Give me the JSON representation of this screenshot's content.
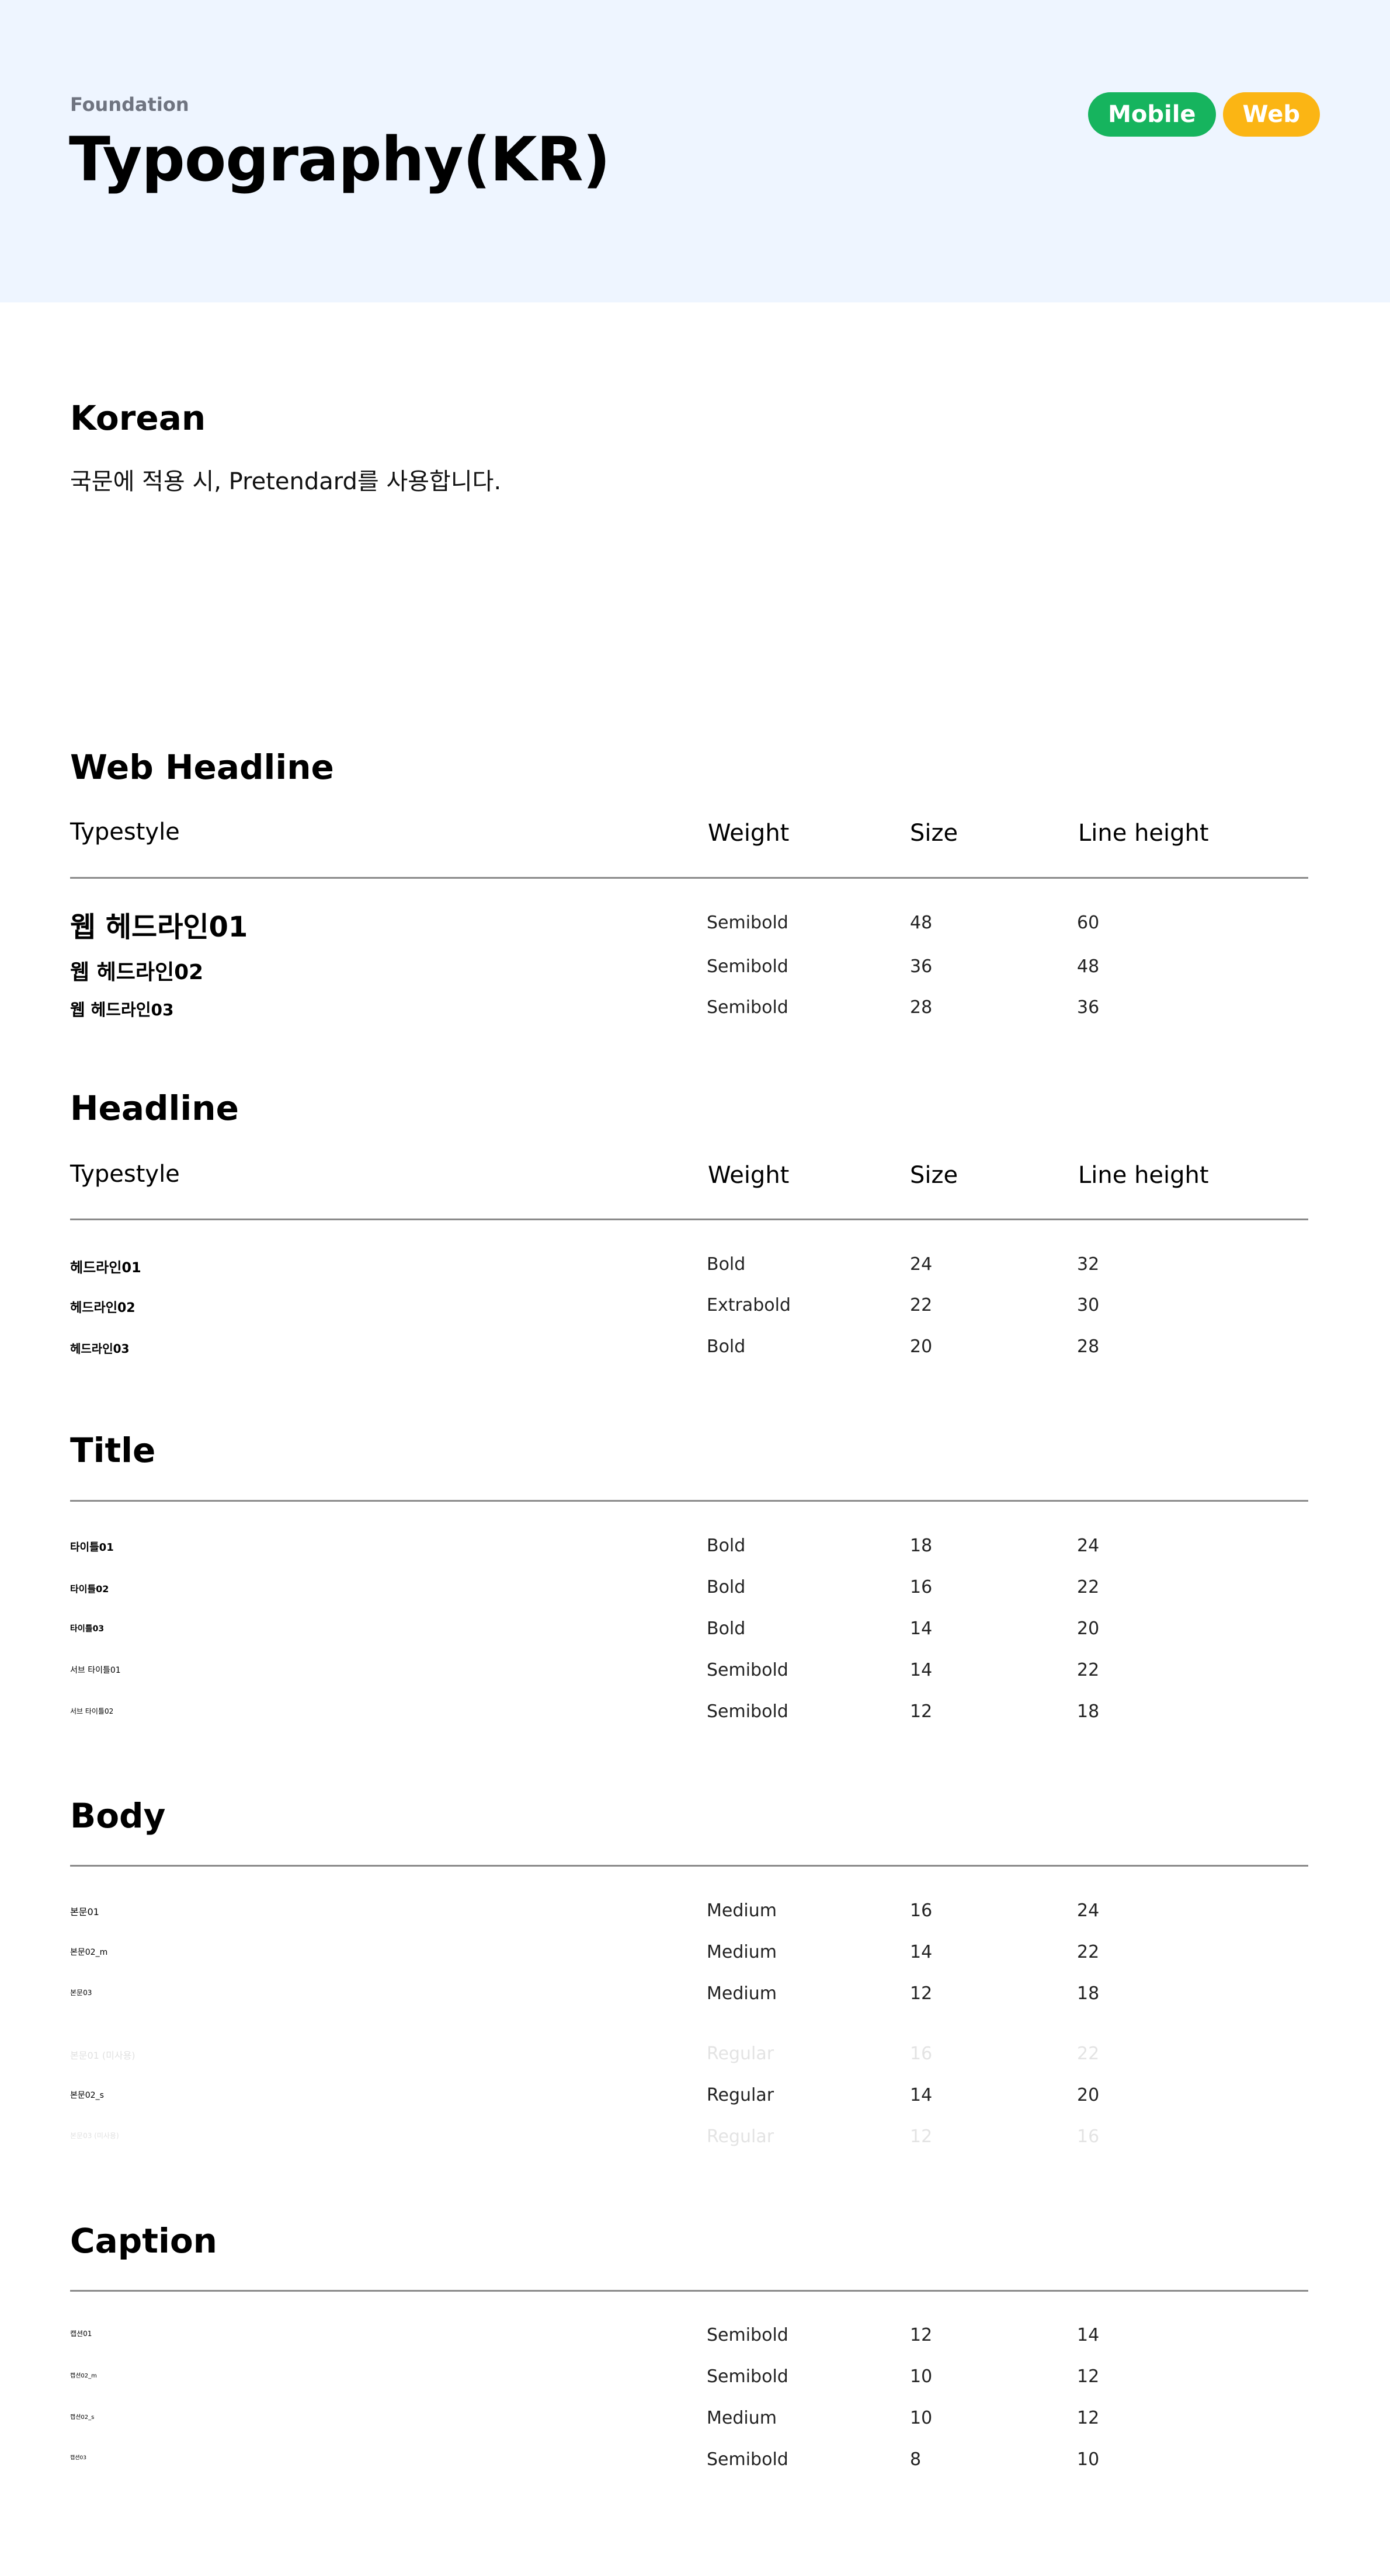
{
  "header": {
    "eyebrow": "Foundation",
    "title": "Typography(KR)",
    "badges": [
      {
        "label": "Mobile",
        "color": "#16b45e"
      },
      {
        "label": "Web",
        "color": "#fbb514"
      }
    ],
    "background": "#eef5ff"
  },
  "intro": {
    "title": "Korean",
    "text": "국문에 적용 시, Pretendard를 사용합니다."
  },
  "columns": {
    "typestyle": "Typestyle",
    "weight": "Weight",
    "size": "Size",
    "line_height": "Line height"
  },
  "sections": {
    "web_headline": {
      "title": "Web Headline",
      "rows": [
        {
          "name": "웹 헤드라인01",
          "weight": "Semibold",
          "size": "48",
          "line_height": "60"
        },
        {
          "name": "웹 헤드라인02",
          "weight": "Semibold",
          "size": "36",
          "line_height": "48"
        },
        {
          "name": "웹 헤드라인03",
          "weight": "Semibold",
          "size": "28",
          "line_height": "36"
        }
      ]
    },
    "headline": {
      "title": "Headline",
      "rows": [
        {
          "name": "헤드라인01",
          "weight": "Bold",
          "size": "24",
          "line_height": "32"
        },
        {
          "name": "헤드라인02",
          "weight": "Extrabold",
          "size": "22",
          "line_height": "30"
        },
        {
          "name": "헤드라인03",
          "weight": "Bold",
          "size": "20",
          "line_height": "28"
        }
      ]
    },
    "title": {
      "title": "Title",
      "rows": [
        {
          "name": "타이틀01",
          "weight": "Bold",
          "size": "18",
          "line_height": "24"
        },
        {
          "name": "타이틀02",
          "weight": "Bold",
          "size": "16",
          "line_height": "22"
        },
        {
          "name": "타이틀03",
          "weight": "Bold",
          "size": "14",
          "line_height": "20"
        },
        {
          "name": "서브 타이틀01",
          "weight": "Semibold",
          "size": "14",
          "line_height": "22"
        },
        {
          "name": "서브 타이틀02",
          "weight": "Semibold",
          "size": "12",
          "line_height": "18"
        }
      ]
    },
    "body": {
      "title": "Body",
      "rows": [
        {
          "name": "본문01",
          "weight": "Medium",
          "size": "16",
          "line_height": "24"
        },
        {
          "name": "본문02_m",
          "weight": "Medium",
          "size": "14",
          "line_height": "22"
        },
        {
          "name": "본문03",
          "weight": "Medium",
          "size": "12",
          "line_height": "18"
        },
        {
          "name": "본문01 (미사용)",
          "weight": "Regular",
          "size": "16",
          "line_height": "22"
        },
        {
          "name": "본문02_s",
          "weight": "Regular",
          "size": "14",
          "line_height": "20"
        },
        {
          "name": "본문03 (미사용)",
          "weight": "Regular",
          "size": "12",
          "line_height": "16"
        }
      ]
    },
    "caption": {
      "title": "Caption",
      "rows": [
        {
          "name": "캡션01",
          "weight": "Semibold",
          "size": "12",
          "line_height": "14"
        },
        {
          "name": "캡션02_m",
          "weight": "Semibold",
          "size": "10",
          "line_height": "12"
        },
        {
          "name": "캡션02_s",
          "weight": "Medium",
          "size": "10",
          "line_height": "12"
        },
        {
          "name": "캡션03",
          "weight": "Semibold",
          "size": "8",
          "line_height": "10"
        }
      ]
    }
  }
}
